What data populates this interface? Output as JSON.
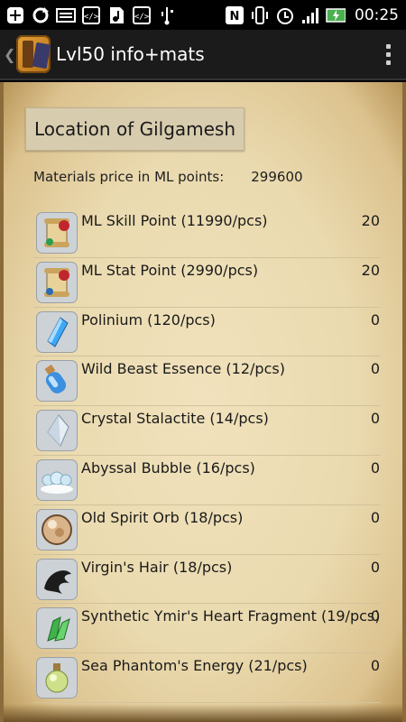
{
  "status_bar": {
    "time": "00:25",
    "icons": [
      "add-icon",
      "sync-icon",
      "keyboard-icon",
      "code-icon",
      "music-icon",
      "code-icon",
      "usb-icon",
      "nfc-icon",
      "vibrate-icon",
      "alarm-icon",
      "signal-icon",
      "battery-icon"
    ]
  },
  "action_bar": {
    "title": "Lvl50 info+mats",
    "app_icon": "book-icon",
    "menu_icon": "overflow-menu-icon"
  },
  "colors": {
    "parchment": "#eadaaf",
    "button": "#d8ccae",
    "battery": "#4caf50"
  },
  "location": {
    "label": "Location of Gilgamesh"
  },
  "materials": {
    "price_label": "Materials price in ML points:",
    "price_value": "299600",
    "items": [
      {
        "name": "ML Skill Point (11990/pcs)",
        "count": "20",
        "icon": "scroll-icon"
      },
      {
        "name": "ML Stat Point (2990/pcs)",
        "count": "20",
        "icon": "scroll-icon"
      },
      {
        "name": "Polinium (120/pcs)",
        "count": "0",
        "icon": "blue-crystal-icon"
      },
      {
        "name": "Wild Beast Essence (12/pcs)",
        "count": "0",
        "icon": "potion-bottle-icon"
      },
      {
        "name": "Crystal Stalactite (14/pcs)",
        "count": "0",
        "icon": "clear-crystal-icon"
      },
      {
        "name": "Abyssal Bubble (16/pcs)",
        "count": "0",
        "icon": "bubbles-icon"
      },
      {
        "name": "Old Spirit Orb (18/pcs)",
        "count": "0",
        "icon": "orb-icon"
      },
      {
        "name": "Virgin's Hair (18/pcs)",
        "count": "0",
        "icon": "hair-icon"
      },
      {
        "name": "Synthetic Ymir's Heart Fragment (19/pcs)",
        "count": "0",
        "icon": "green-crystal-icon"
      },
      {
        "name": "Sea Phantom's Energy (21/pcs)",
        "count": "0",
        "icon": "flask-icon"
      }
    ]
  }
}
